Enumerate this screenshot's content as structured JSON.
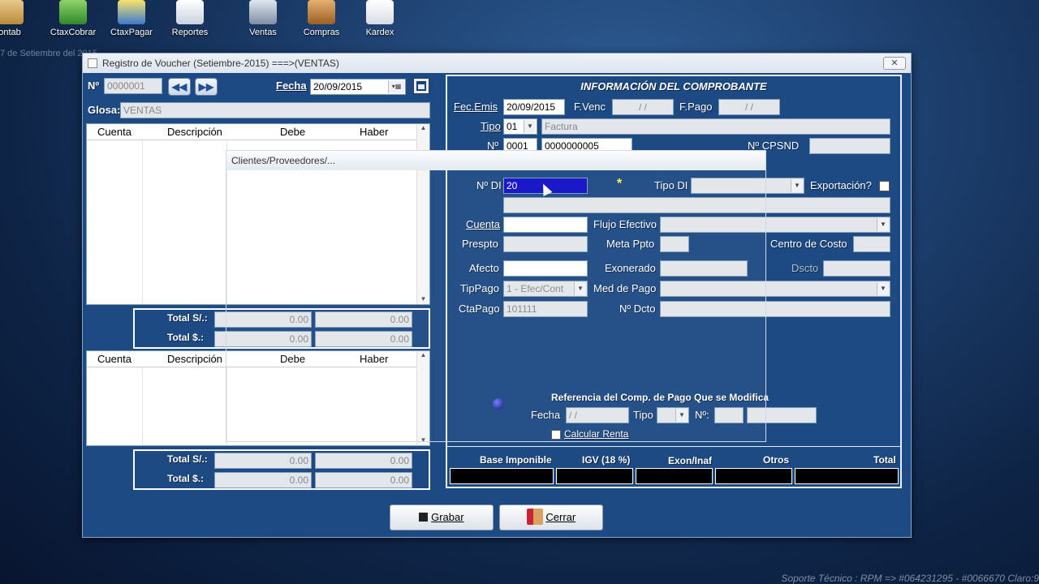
{
  "desktop": {
    "icons": [
      {
        "label": "ontab",
        "icon": "contab-icon"
      },
      {
        "label": "CtaxCobrar",
        "icon": "money-icon"
      },
      {
        "label": "CtaxPagar",
        "icon": "person-icon"
      },
      {
        "label": "Reportes",
        "icon": "report-icon"
      },
      {
        "label": "Ventas",
        "icon": "sales-icon"
      },
      {
        "label": "Compras",
        "icon": "box-icon"
      },
      {
        "label": "Kardex",
        "icon": "kardex-icon"
      }
    ],
    "date_text": "7 de Setiembre del 2015",
    "footer": "Soporte Técnico : RPM => #064231295 - #0066670 Claro:9"
  },
  "window": {
    "title": "Registro de Voucher (Setiembre-2015)  ===>(VENTAS)",
    "close": "✕"
  },
  "header": {
    "num_label": "Nº",
    "num_value": "0000001",
    "fecha_label": "Fecha",
    "fecha_value": "20/09/2015",
    "glosa_label": "Glosa:",
    "glosa_value": "VENTAS"
  },
  "grid": {
    "columns": [
      "Cuenta",
      "Descripción",
      "Debe",
      "Haber"
    ]
  },
  "totals": {
    "soles_label": "Total S/.:",
    "dolares_label": "Total $.:",
    "zero": "0.00"
  },
  "info": {
    "title": "INFORMACIÓN DEL COMPROBANTE",
    "fec_emis_label": "Fec.Emis",
    "fec_emis_value": "20/09/2015",
    "fvenc_label": "F.Venc",
    "fvenc_value": "/ /",
    "fpago_label": "F.Pago",
    "fpago_value": "/ /",
    "tipo_label": "Tipo",
    "tipo_value": "01",
    "tipo_desc": "Factura",
    "num_label": "Nº",
    "serie_value": "0001",
    "numero_value": "0000000005",
    "cpsnd_label": "Nº  CPSND",
    "ndi_label": "Nº DI",
    "ndi_value": "20",
    "star": "*",
    "tipodi_label": "Tipo DI",
    "exportacion_label": "Exportación?",
    "cuenta_label": "Cuenta",
    "flujo_label": "Flujo Efectivo",
    "prespto_label": "Prespto",
    "meta_label": "Meta Ppto",
    "centro_label": "Centro de Costo",
    "afecto_label": "Afecto",
    "exonerado_label": "Exonerado",
    "dscto_label": "Dscto",
    "tippago_label": "TipPago",
    "tippago_value": "1 - Efec/Cont",
    "medpago_label": "Med de Pago",
    "ctapago_label": "CtaPago",
    "ctapago_value": "101111",
    "ndcto_label": "Nº Dcto",
    "ref_title": "Referencia del Comp. de Pago Que se Modifica",
    "ref_fecha_label": "Fecha",
    "ref_fecha_value": "/ /",
    "ref_tipo_label": "Tipo",
    "ref_num_label": "Nº:",
    "calcular_label": "Calcular Renta"
  },
  "footer_cols": {
    "base": "Base Imponible",
    "igv": "IGV (18  %)",
    "exon": "Exon/Inaf",
    "otros": "Otros",
    "total": "Total"
  },
  "popup": {
    "title": "Clientes/Proveedores/..."
  },
  "buttons": {
    "grabar": "Grabar",
    "cerrar": "Cerrar"
  },
  "colors": {
    "window_bg": "#1e4a84",
    "highlight": "#1010c8"
  }
}
